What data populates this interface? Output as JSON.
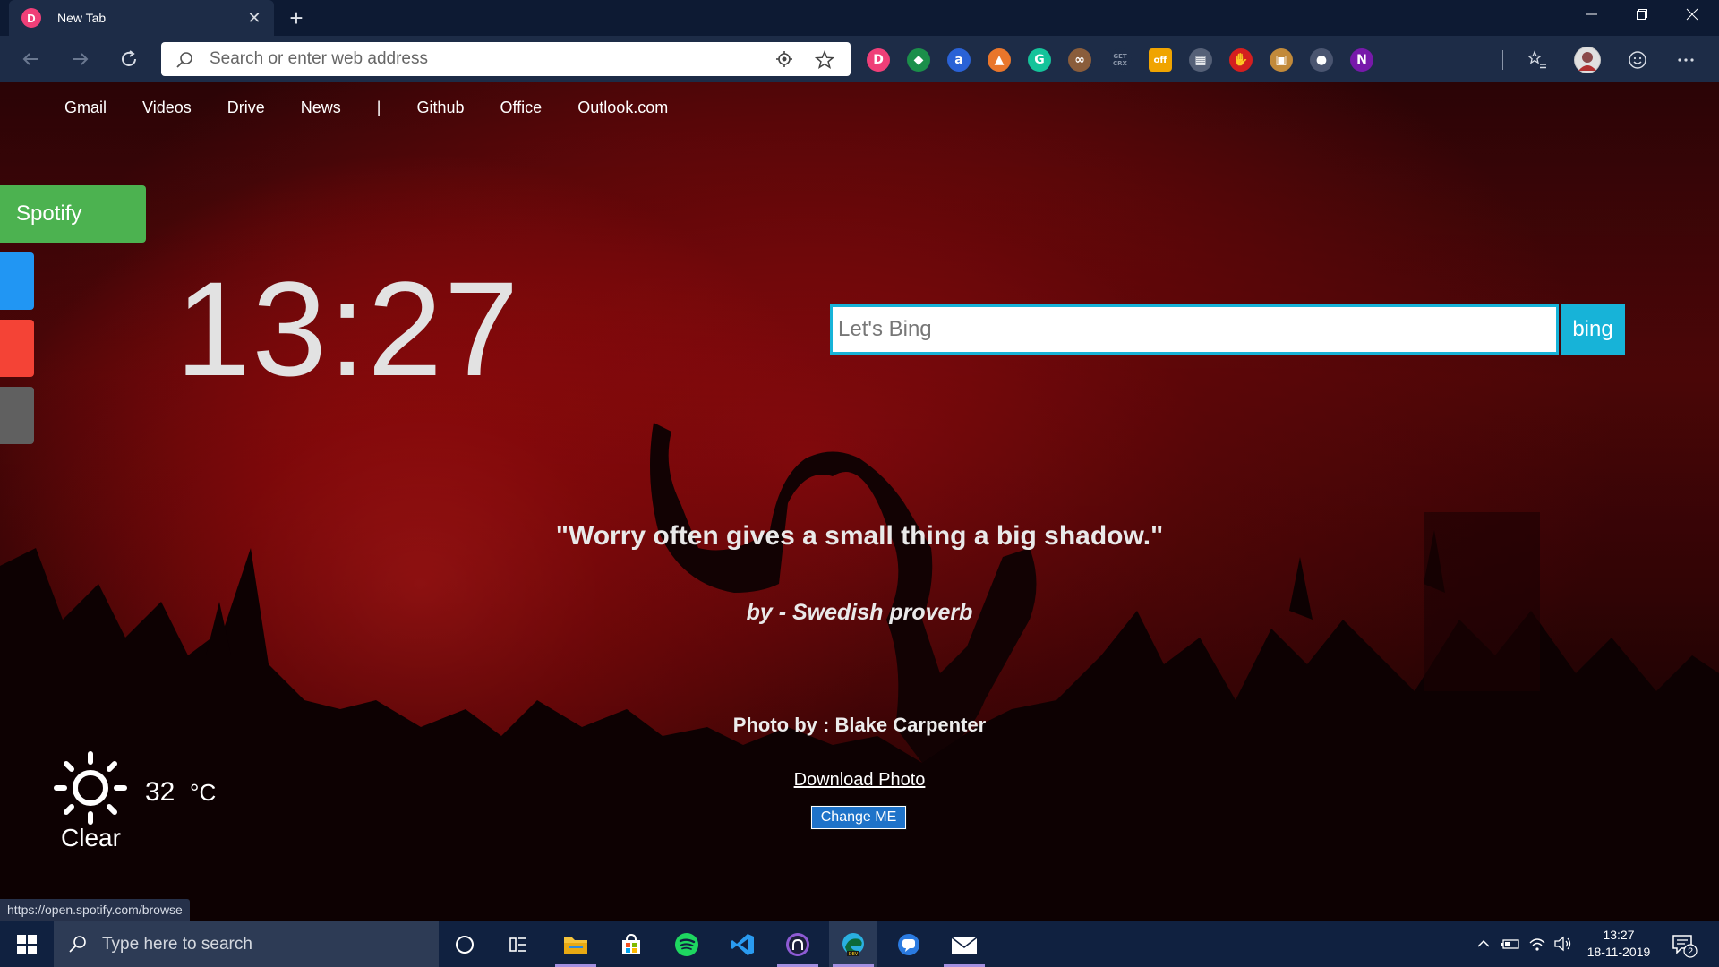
{
  "browser": {
    "tab_title": "New Tab",
    "tab_favicon_text": "D",
    "address_placeholder": "Search or enter web address",
    "extensions": [
      {
        "name": "dev-circle-ext",
        "text": "D",
        "color": "#ef3f78"
      },
      {
        "name": "colorful-ext",
        "text": "◆",
        "color": "#1b8f4a"
      },
      {
        "name": "grammar-a-ext",
        "text": "a",
        "color": "#2a62d6"
      },
      {
        "name": "fox-ext",
        "text": "▲",
        "color": "#e9762b"
      },
      {
        "name": "grammarly-ext",
        "text": "G",
        "color": "#15c39a"
      },
      {
        "name": "glasses-ext",
        "text": "∞",
        "color": "#8a5d3b"
      },
      {
        "name": "get-crx-ext",
        "text": "GET CRX",
        "color": "#1d2c47"
      },
      {
        "name": "off-badge-ext",
        "text": "off",
        "color": "#f0a400"
      },
      {
        "name": "grid-ext",
        "text": "▦",
        "color": "#556077"
      },
      {
        "name": "red-hand-ext",
        "text": "✋",
        "color": "#d41f1f"
      },
      {
        "name": "box-ext",
        "text": "▣",
        "color": "#c28a3a"
      },
      {
        "name": "white-circle-ext",
        "text": "●",
        "color": "#4a5570"
      },
      {
        "name": "onenote-ext",
        "text": "N",
        "color": "#7719aa"
      }
    ]
  },
  "page": {
    "quicklinks": [
      "Gmail",
      "Videos",
      "Drive",
      "News",
      "|",
      "Github",
      "Office",
      "Outlook.com"
    ],
    "spotify_label": "Spotify",
    "side_buttons": [
      {
        "name": "side-button-blue",
        "color": "#2196f3"
      },
      {
        "name": "side-button-red",
        "color": "#f44336"
      },
      {
        "name": "side-button-gray",
        "color": "#606060"
      }
    ],
    "clock": "13:27",
    "bing": {
      "placeholder": "Let's Bing",
      "button": "bing"
    },
    "quote": "\"Worry often gives a small thing a big shadow.\"",
    "author": "by - Swedish proverb",
    "photo_credit": "Photo by : Blake Carpenter",
    "download_link": "Download Photo",
    "change_button": "Change ME",
    "weather": {
      "temp": "32",
      "unit": "°C",
      "condition": "Clear"
    },
    "status_url": "https://open.spotify.com/browse"
  },
  "taskbar": {
    "search_placeholder": "Type here to search",
    "apps": [
      "cortana",
      "task-view",
      "file-explorer",
      "store",
      "spotify",
      "vscode",
      "github-desktop",
      "edge-dev",
      "messages",
      "mail"
    ],
    "time": "13:27",
    "date": "18-11-2019",
    "notification_count": "2"
  }
}
